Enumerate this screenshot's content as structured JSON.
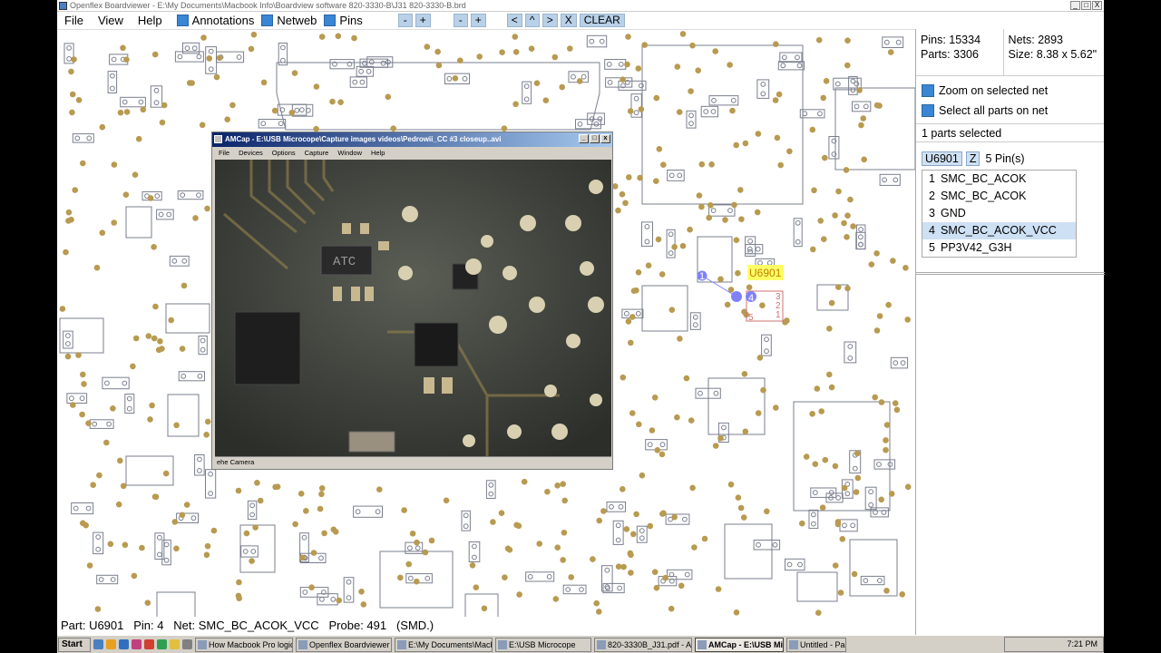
{
  "window": {
    "title": "Openflex Boardviewer - E:\\My Documents\\Macbook Info\\Boardview software 820-3330-B\\J31 820-3330-B.brd",
    "controls": [
      "_",
      "□",
      "X"
    ]
  },
  "menu": {
    "items": [
      "File",
      "View",
      "Help"
    ],
    "checks": [
      "Annotations",
      "Netweb",
      "Pins"
    ],
    "buttons": [
      "-",
      "+",
      "-",
      "+",
      "<",
      "^",
      ">",
      "X",
      "CLEAR"
    ]
  },
  "panel": {
    "pins": "Pins: 15334",
    "parts": "Parts: 3306",
    "nets": "Nets: 2893",
    "size": "Size: 8.38 x 5.62\"",
    "zoom_option": "Zoom on selected net",
    "select_option": "Select all parts on net",
    "selected_count": "1 parts selected",
    "part_name": "U6901",
    "z_button": "Z",
    "pin_count": "5 Pin(s)",
    "pins_list": [
      {
        "n": "1",
        "net": "SMC_BC_ACOK"
      },
      {
        "n": "2",
        "net": "SMC_BC_ACOK"
      },
      {
        "n": "3",
        "net": "GND"
      },
      {
        "n": "4",
        "net": "SMC_BC_ACOK_VCC"
      },
      {
        "n": "5",
        "net": "PP3V42_G3H"
      }
    ],
    "selected_pin_index": 3
  },
  "board": {
    "part_label": "U6901",
    "pin_labels": [
      "1",
      "4",
      "3",
      "2",
      "5",
      "1"
    ]
  },
  "status": {
    "text": "Part: U6901   Pin: 4   Net: SMC_BC_ACOK_VCC   Probe: 491   (SMD.)"
  },
  "amcap": {
    "title": "AMCap - E:\\USB Microcope\\Capture images videos\\Pedrowii_CC #3 closeup..avi",
    "menu": [
      "File",
      "Devices",
      "Options",
      "Capture",
      "Window",
      "Help"
    ],
    "status": "ehe Camera",
    "chip_marking": "ATC"
  },
  "taskbar": {
    "start": "Start",
    "tasks": [
      "How Macbook Pro logic b...",
      "Openflex Boardviewer - ...",
      "E:\\My Documents\\Macbo...",
      "E:\\USB Microcope",
      "820-3330B_J31.pdf - Ad...",
      "AMCap - E:\\USB Micro...",
      "Untitled - Paint"
    ],
    "active_task_index": 5,
    "clock": "7:21 PM"
  },
  "colors": {
    "via": "#b89a50",
    "outline": "#7a7f8e",
    "accent": "#3a86d4",
    "highlight": "#ffff66",
    "selected_pin": "#8080ff"
  }
}
